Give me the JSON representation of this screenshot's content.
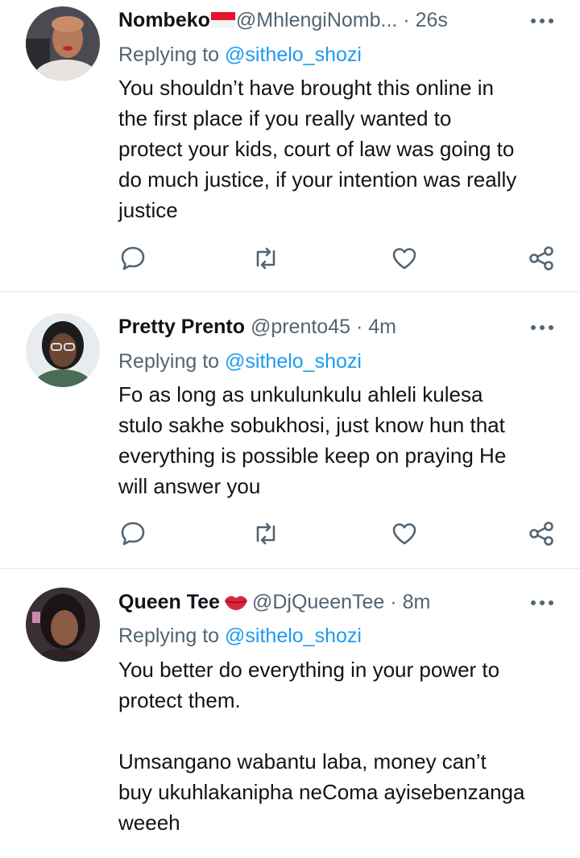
{
  "tweets": [
    {
      "name": "Nombeko",
      "name_icon": "indonesia-flag-icon",
      "handle": "@MhlengiNomb...",
      "dot": "·",
      "time": "26s",
      "replying_prefix": "Replying to ",
      "replying_to": "@sithelo_shozi",
      "text": "You shouldn’t have brought this online in\nthe first place if you really wanted to\nprotect your kids, court of law was going to\ndo much justice, if your intention was really\njustice"
    },
    {
      "name": "Pretty Prento",
      "handle": "@prento45",
      "dot": "·",
      "time": "4m",
      "replying_prefix": "Replying to ",
      "replying_to": "@sithelo_shozi",
      "text": "Fo as long as unkulunkulu ahleli kulesa\nstulo sakhe sobukhosi, just know hun that\neverything is possible keep on praying He\nwill answer you"
    },
    {
      "name": "Queen Tee",
      "name_icon": "kiss-lips-icon",
      "handle": "@DjQueenTee",
      "dot": "·",
      "time": "8m",
      "replying_prefix": "Replying to ",
      "replying_to": "@sithelo_shozi",
      "text": "You better do everything in your power to\nprotect them.\n\nUmsangano wabantu laba, money can’t\nbuy ukuhlakanipha neComa ayisebenzanga\nweeeh"
    }
  ],
  "actions": [
    "reply-icon",
    "retweet-icon",
    "like-icon",
    "share-icon"
  ],
  "colors": {
    "text": "#0f1419",
    "muted": "#536471",
    "link": "#1d9bf0",
    "divider": "#e6e6e6"
  }
}
